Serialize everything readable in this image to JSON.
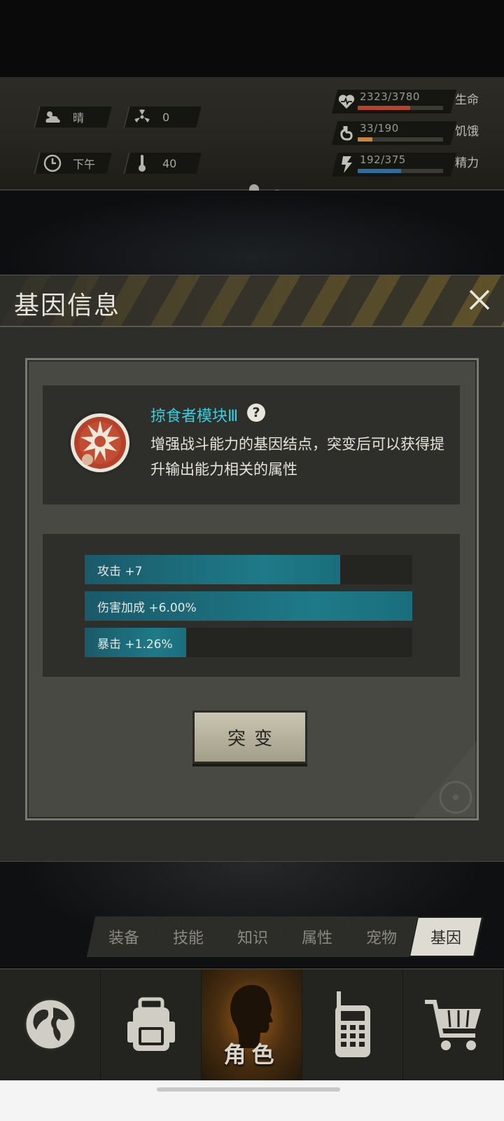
{
  "status": {
    "weather": {
      "icon": "cloud-sun-icon",
      "label": "晴"
    },
    "radiation": {
      "icon": "radiation-icon",
      "value": "0"
    },
    "time": {
      "icon": "clock-icon",
      "label": "下午"
    },
    "temperature": {
      "icon": "thermometer-icon",
      "value": "40"
    },
    "vitals": [
      {
        "name": "生命",
        "icon": "heart-icon",
        "display": "2323/3780",
        "current": 2323,
        "max": 3780,
        "color": "#b5432e"
      },
      {
        "name": "饥饿",
        "icon": "stomach-icon",
        "display": "33/190",
        "current": 33,
        "max": 190,
        "color": "#c9853a"
      },
      {
        "name": "精力",
        "icon": "energy-icon",
        "display": "192/375",
        "current": 192,
        "max": 375,
        "color": "#2d6ea0"
      }
    ]
  },
  "dialog": {
    "title": "基因信息",
    "gene": {
      "name": "掠食者模块Ⅲ",
      "description": "增强战斗能力的基因结点，突变后可以获得提升输出能力相关的属性"
    },
    "stats": [
      {
        "label": "攻击 +7",
        "fill": 0.78
      },
      {
        "label": "伤害加成 +6.00%",
        "fill": 1.0
      },
      {
        "label": "暴击 +1.26%",
        "fill": 0.31
      }
    ],
    "mutate_label": "突变"
  },
  "sub_tabs": [
    {
      "label": "装备",
      "active": false
    },
    {
      "label": "技能",
      "active": false
    },
    {
      "label": "知识",
      "active": false
    },
    {
      "label": "属性",
      "active": false
    },
    {
      "label": "宠物",
      "active": false
    },
    {
      "label": "基因",
      "active": true
    }
  ],
  "bottom_nav": [
    {
      "icon": "globe-icon",
      "label": ""
    },
    {
      "icon": "backpack-icon",
      "label": ""
    },
    {
      "icon": "character-head-icon",
      "label": "角色",
      "active": true
    },
    {
      "icon": "walkie-talkie-icon",
      "label": ""
    },
    {
      "icon": "cart-icon",
      "label": ""
    }
  ],
  "colors": {
    "accent_cyan": "#35d0e0",
    "stat_fill": "#1e7a88"
  }
}
